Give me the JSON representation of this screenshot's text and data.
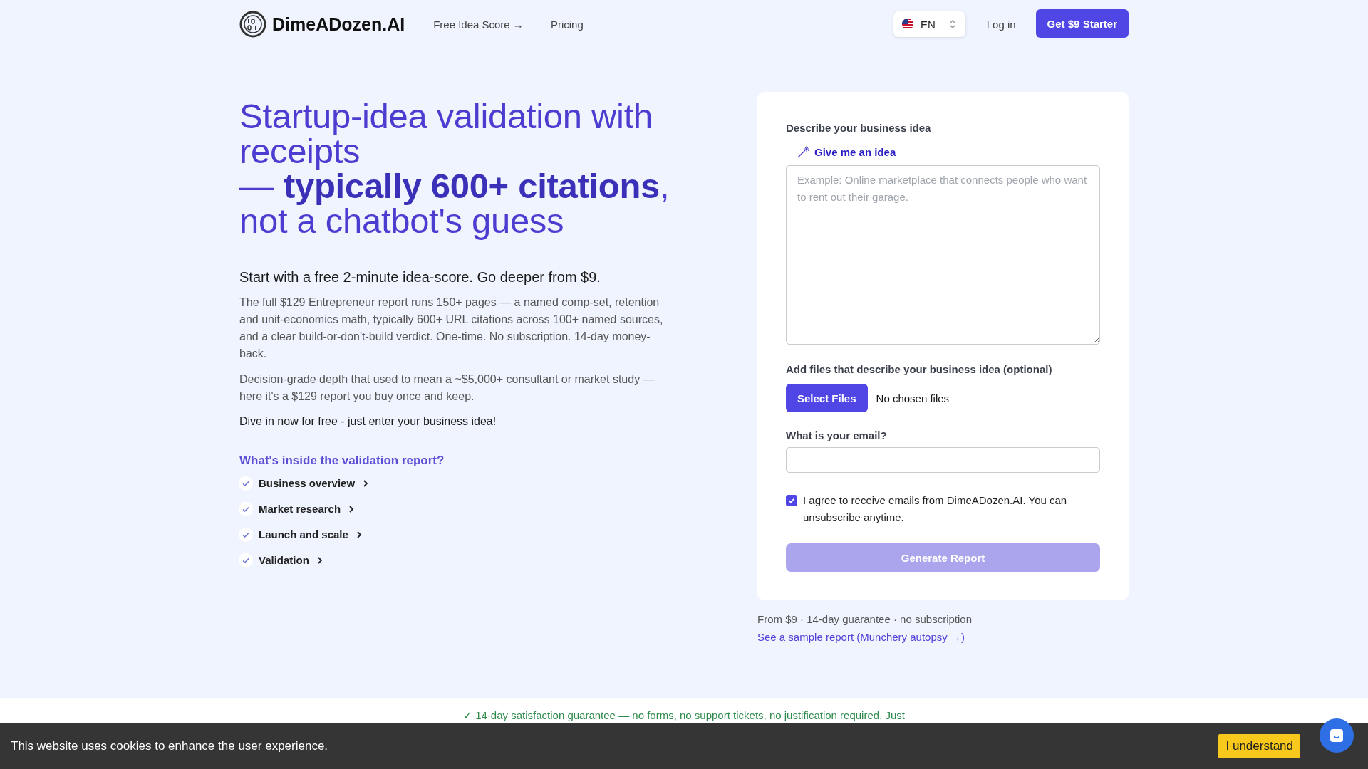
{
  "header": {
    "logo": "DimeADozen.AI",
    "nav": [
      "Free Idea Score →",
      "Pricing"
    ],
    "language": "EN",
    "login": "Log in",
    "cta": "Get $9 Starter"
  },
  "hero": {
    "headline_lines": [
      "Startup-idea validation with receipts",
      "— **typically 600+ citations**, not a chatbot's guess"
    ],
    "subheading": "Start with a free 2-minute idea-score. Go deeper from $9.",
    "paragraphs": [
      "The full $129 Entrepreneur report runs 150+ pages — a named comp-set, retention and unit-economics math, typically 600+ URL citations across 100+ named sources, and a clear build-or-don't-build verdict. One-time. No subscription. 14-day money-back.",
      "Decision-grade depth that used to mean a ~$5,000+ consultant or market study — here it's a $129 report you buy once and keep."
    ],
    "cta_text": "Dive in now for free - just enter your business idea!",
    "report_title": "What's inside the validation report?",
    "report_items": [
      {
        "label": "Business overview",
        "expanded": false
      },
      {
        "label": "Market research",
        "expanded": false
      },
      {
        "label": "Launch and scale",
        "expanded": false
      },
      {
        "label": "Validation",
        "expanded": false
      }
    ]
  },
  "form": {
    "idea_label": "Describe your business idea",
    "idea_button": "Give me an idea",
    "idea_placeholder": "Example: Online marketplace that connects people who want to rent out their garage.",
    "files_label": "Add files that describe your business idea (optional)",
    "files_button": "Select Files",
    "files_status": "No chosen files",
    "email_label": "What is your email?",
    "consent": {
      "text": "I agree to receive emails from DimeADozen.AI. You can unsubscribe anytime.",
      "checked": true
    },
    "submit": {
      "label": "Generate Report",
      "disabled": true
    }
  },
  "below_form": {
    "note": "From $9 · 14-day guarantee · no subscription",
    "link": "See a sample report (Munchery autopsy →)"
  },
  "guarantee": "✓ 14-day satisfaction guarantee — no forms, no support tickets, no justification required. Just",
  "cookie_bar": {
    "text": "This website uses cookies to enhance the user experience.",
    "button": "I understand"
  }
}
